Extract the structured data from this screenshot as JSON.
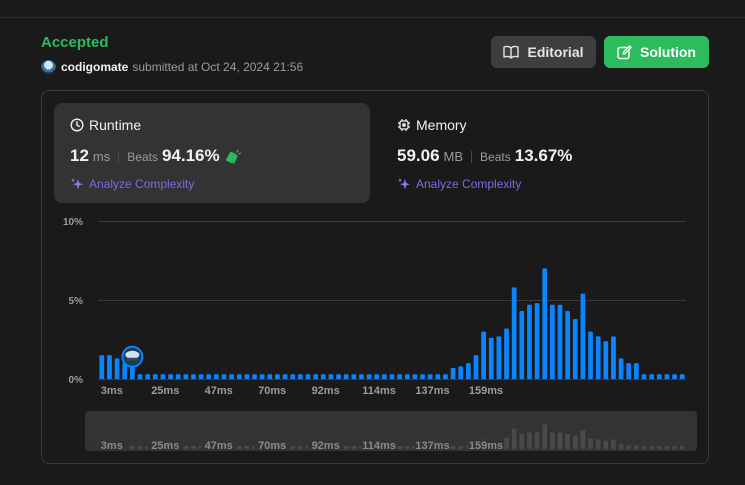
{
  "submission": {
    "status": "Accepted",
    "username": "codigomate",
    "submitted_text": "submitted at Oct 24, 2024 21:56"
  },
  "actions": {
    "editorial_label": "Editorial",
    "solution_label": "Solution"
  },
  "runtime": {
    "title": "Runtime",
    "value": "12",
    "unit": "ms",
    "beats_label": "Beats",
    "beats_value": "94.16%",
    "analyze_label": "Analyze Complexity"
  },
  "memory": {
    "title": "Memory",
    "value": "59.06",
    "unit": "MB",
    "beats_label": "Beats",
    "beats_value": "13.67%",
    "analyze_label": "Analyze Complexity"
  },
  "colors": {
    "accepted": "#2cbb5d",
    "bar": "#0a84ff",
    "analyze": "#7d6ae0",
    "mini_bar": "#4a4a4a"
  },
  "chart_data": {
    "type": "bar",
    "ylabel": "",
    "xlabel": "",
    "y_ticks": [
      "10%",
      "5%",
      "0%"
    ],
    "ylim": [
      0,
      10
    ],
    "x_tick_labels": [
      "3ms",
      "25ms",
      "47ms",
      "70ms",
      "92ms",
      "114ms",
      "137ms",
      "159ms"
    ],
    "x_tick_positions": [
      0,
      7,
      14,
      21,
      28,
      35,
      42,
      49
    ],
    "values": [
      1.5,
      1.5,
      1.3,
      1.0,
      0.9,
      0.3,
      0.3,
      0.3,
      0.3,
      0.3,
      0.3,
      0.3,
      0.3,
      0.3,
      0.3,
      0.3,
      0.3,
      0.3,
      0.3,
      0.3,
      0.3,
      0.3,
      0.3,
      0.3,
      0.3,
      0.3,
      0.3,
      0.3,
      0.3,
      0.3,
      0.3,
      0.3,
      0.3,
      0.3,
      0.3,
      0.3,
      0.3,
      0.3,
      0.3,
      0.3,
      0.3,
      0.3,
      0.3,
      0.3,
      0.3,
      0.3,
      0.7,
      0.8,
      1.0,
      1.5,
      3.0,
      2.6,
      2.7,
      3.2,
      5.8,
      4.3,
      4.7,
      4.8,
      7.0,
      4.7,
      4.7,
      4.3,
      3.8,
      5.4,
      3.0,
      2.7,
      2.4,
      2.7,
      1.3,
      1.0,
      1.0,
      0.3,
      0.3,
      0.3,
      0.3,
      0.3,
      0.3
    ],
    "user_bar_index": 4,
    "grid": true
  }
}
